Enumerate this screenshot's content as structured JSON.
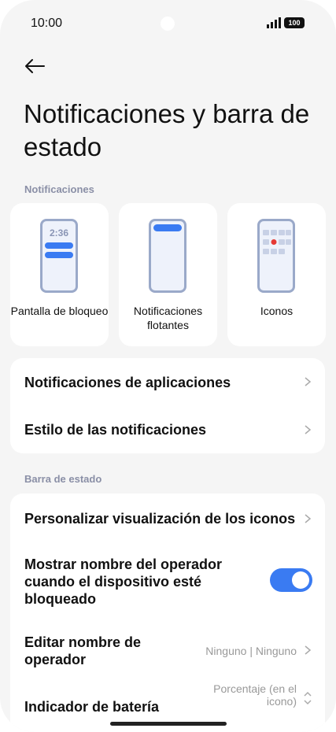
{
  "status_bar": {
    "time": "10:00",
    "battery": "100"
  },
  "page_title": "Notificaciones y barra de estado",
  "notifications_section": {
    "label": "Notificaciones",
    "tiles": [
      {
        "label": "Pantalla de bloqueo",
        "preview_time": "2:36"
      },
      {
        "label": "Notificaciones flotantes"
      },
      {
        "label": "Iconos"
      }
    ],
    "rows": [
      {
        "title": "Notificaciones de aplicaciones"
      },
      {
        "title": "Estilo de las notificaciones"
      }
    ]
  },
  "status_bar_section": {
    "label": "Barra de estado",
    "rows": [
      {
        "title": "Personalizar visualización de los iconos"
      },
      {
        "title": "Mostrar nombre del operador cuando el dispositivo esté bloqueado",
        "toggle_on": true
      },
      {
        "title": "Editar nombre de operador",
        "value": "Ninguno | Ninguno"
      },
      {
        "title": "Indicador de batería",
        "value": "Porcentaje (en el icono)"
      }
    ]
  },
  "colors": {
    "accent": "#3a7bf2",
    "background": "#f5f5f5",
    "section_label": "#8a8fa6"
  }
}
